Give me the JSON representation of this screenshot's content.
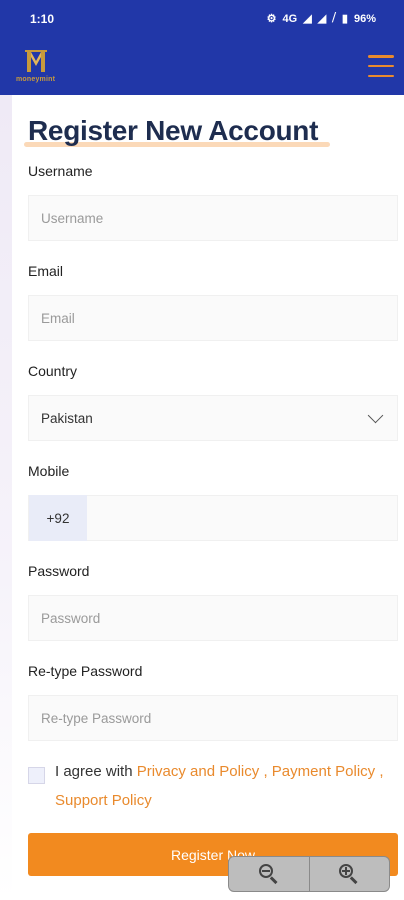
{
  "status_bar": {
    "time": "1:10",
    "network": "4G",
    "battery": "96%",
    "icons": [
      "sync-icon",
      "signal-icon",
      "wifi-signal-icon",
      "no-sim-icon",
      "battery-icon"
    ]
  },
  "app_bar": {
    "logo_text": "moneymint",
    "menu_icon": "hamburger-menu-icon",
    "accent_color": "#e98a2d",
    "bar_color": "#2137a8"
  },
  "form": {
    "title": "Register New Account",
    "username": {
      "label": "Username",
      "placeholder": "Username"
    },
    "email": {
      "label": "Email",
      "placeholder": "Email"
    },
    "country": {
      "label": "Country",
      "value": "Pakistan"
    },
    "mobile": {
      "label": "Mobile",
      "prefix": "+92",
      "value": ""
    },
    "password": {
      "label": "Password",
      "placeholder": "Password"
    },
    "retype_password": {
      "label": "Re-type Password",
      "placeholder": "Re-type Password"
    },
    "agree": {
      "prefix": "I agree with ",
      "privacy": "Privacy and Policy",
      "sep1": " , ",
      "payment": "Payment Policy",
      "sep2": " , ",
      "support": "Support Policy"
    },
    "submit_label": "Register Now",
    "button_color": "#f28a1f"
  },
  "zoom_control": {
    "zoom_out_icon": "zoom-out-icon",
    "zoom_in_icon": "zoom-in-icon"
  }
}
